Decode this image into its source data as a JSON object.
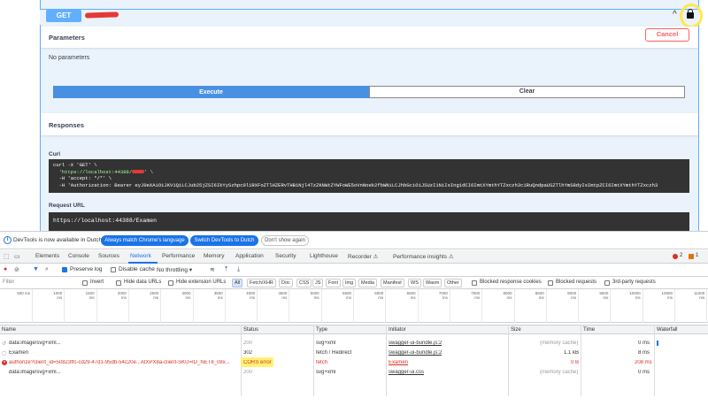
{
  "swagger": {
    "method": "GET",
    "parameters_title": "Parameters",
    "cancel_label": "Cancel",
    "no_params": "No parameters",
    "execute_label": "Execute",
    "clear_label": "Clear",
    "responses_title": "Responses",
    "curl_label": "Curl",
    "curl_line1": "curl -X 'GET' \\",
    "curl_line2_a": "  'https://localhost:44388/",
    "curl_line2_b": "' \\",
    "curl_line3": "  -H 'accept: */*' \\",
    "curl_line4": "  -H 'Authorization: Bearer eyJ0eXAiOiJKV1QiLCJub25jZSI6IkYySzhpc0l1RXFoZTlHZERvTHB1Njl4TzZKNWtZYWFoWE5oVnNoek2fbWNiLCJhbGciOiJSUzI1NiIsIng1dCI6ImtXYmthYTZxczh3c1RuQndpaUSZTlhYmS8dyIsImtpZCI6ImtXYmthYTZxczh3",
    "request_url_label": "Request URL",
    "request_url": "https://localhost:44388/Examen"
  },
  "devtools": {
    "infobar": {
      "text": "DevTools is now available in Dutch!",
      "btn_match": "Always match Chrome's language",
      "btn_switch": "Switch DevTools to Dutch",
      "btn_dont": "Don't show again"
    },
    "tabs": [
      "Elements",
      "Console",
      "Sources",
      "Network",
      "Performance",
      "Memory",
      "Application",
      "Security",
      "Lighthouse",
      "Recorder ⚠",
      "Performance insights ⚠"
    ],
    "active_tab": "Network",
    "errors_count": "2",
    "warnings_count": "1",
    "netbar": {
      "preserve_log": "Preserve log",
      "disable_cache": "Disable cache",
      "throttling": "No throttling ▾"
    },
    "filter": {
      "placeholder": "Filter",
      "invert": "Invert",
      "hide_data_urls": "Hide data URLs",
      "hide_ext_urls": "Hide extension URLs",
      "types": [
        "All",
        "Fetch/XHR",
        "Doc",
        "CSS",
        "JS",
        "Font",
        "Img",
        "Media",
        "Manifest",
        "WS",
        "Wasm",
        "Other"
      ],
      "blocked_cookies": "Blocked response cookies",
      "blocked_requests": "Blocked requests",
      "third_party": "3rd-party requests"
    },
    "ticks": [
      "500 ms",
      "1000 ms",
      "1500 ms",
      "2000 ms",
      "2500 ms",
      "3000 ms",
      "3500 ms",
      "4000 ms",
      "4500 ms",
      "5000 ms",
      "5500 ms",
      "6000 ms",
      "6500 ms",
      "7000 ms",
      "7500 ms",
      "8000 ms",
      "8500 ms",
      "9000 ms",
      "9500 ms",
      "10000 ms",
      "10500 ms",
      "11000 ms"
    ],
    "columns": [
      "Name",
      "Status",
      "Type",
      "Initiator",
      "Size",
      "Time",
      "Waterfall"
    ],
    "rows": [
      {
        "name": "data:image/svg+xml...",
        "status": "200",
        "type": "svg+xml",
        "initiator": "swagger-ui-bundle.js:2",
        "size": "(memory cache)",
        "time": "0 ms"
      },
      {
        "name": "Examen",
        "status": "302",
        "type": "fetch / Redirect",
        "initiator": "swagger-ui-bundle.js:2",
        "size": "1.1 kB",
        "time": "8 ms"
      },
      {
        "name": "authorize?client_id=50823ffc-cd29-47d1-95db-54c20e...AtXPX8a-client-SKU=ID_NET8_08x...",
        "status": "CORS error",
        "type": "fetch",
        "initiator": "Examen",
        "size": "0 B",
        "time": "208 ms"
      },
      {
        "name": "data:image/svg+xml...",
        "status": "200",
        "type": "svg+xml",
        "initiator": "swagger-ui.css",
        "size": "(memory cache)",
        "time": "0 ms"
      }
    ]
  },
  "colors": {
    "swagger_blue": "#61affe",
    "execute_blue": "#4990e2",
    "cancel_red": "#ff6060",
    "devtools_blue": "#1a73e8",
    "error_red": "#d93025",
    "highlight_yellow": "#fff176"
  }
}
